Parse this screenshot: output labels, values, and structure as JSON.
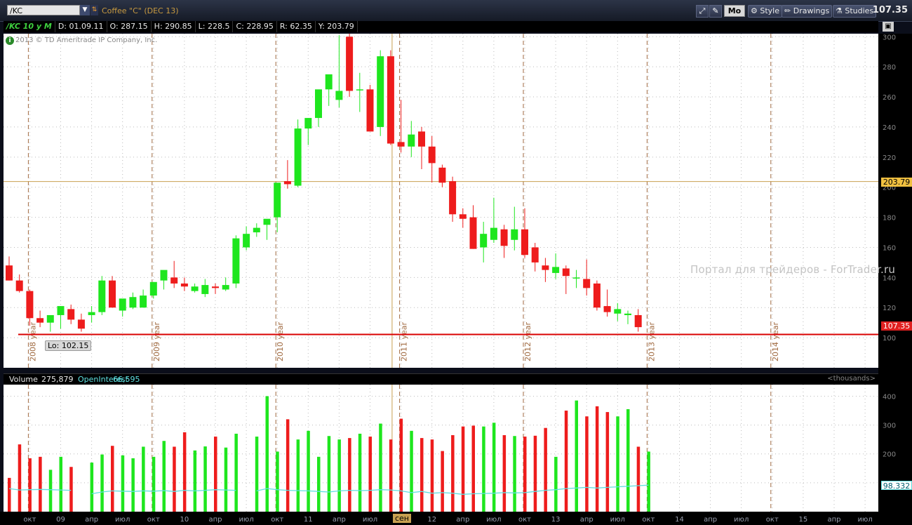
{
  "toolbar": {
    "symbol": "/KC",
    "description": "Coffee \"C\" (DEC 13)",
    "period_button": "Mo",
    "style_label": "Style",
    "drawings_label": "Drawings",
    "studies_label": "Studies",
    "last_price": "107.35"
  },
  "infobar": {
    "tag": "/KC 10 y M",
    "date": "D: 01.09.11",
    "open": "O: 287.15",
    "high": "H: 290.85",
    "low": "L: 228.5",
    "close": "C: 228.95",
    "range": "R: 62.35",
    "y": "Y: 203.79"
  },
  "copyright": "2013 © TD Ameritrade IP Company, Inc.",
  "watermark": "Портал для трейдеров - ForTrader.ru",
  "lo_label": "Lo: 102.15",
  "badges": {
    "crosshair_price": "203.79",
    "last_price": "107.35",
    "openinterest_value": "98.332",
    "crosshair_month": "сен"
  },
  "volume_header": {
    "volume_label": "Volume",
    "volume_value": "275,879",
    "oi_label": "OpenInterest",
    "oi_value": "66,595",
    "units": "<thousands>"
  },
  "colors": {
    "up": "#1ee61e",
    "down": "#ee1c1c",
    "openinterest": "#5fe0e0",
    "support_line": "#d90000",
    "crosshair": "#c8a050"
  },
  "chart_data": [
    {
      "type": "candlestick",
      "title": "",
      "xlabel": "",
      "ylabel": "",
      "ylim": [
        80,
        302
      ],
      "y_ticks": [
        100,
        120,
        140,
        160,
        180,
        200,
        220,
        240,
        260,
        280,
        300
      ],
      "support_level": 102.15,
      "crosshair_y": 203.79,
      "crosshair_date": "2011-09",
      "year_markers": [
        "2008 year",
        "2009 year",
        "2010 year",
        "2011 year",
        "2012 year",
        "2013 year",
        "2014 year"
      ],
      "year_marker_dates": [
        "2008-10",
        "2009-10",
        "2010-10",
        "2011-10",
        "2012-10",
        "2013-10",
        "2014-10"
      ],
      "start_month": "2008-08",
      "candles": [
        [
          148,
          154,
          138,
          138
        ],
        [
          138,
          142,
          130,
          131
        ],
        [
          131,
          132,
          108,
          113
        ],
        [
          113,
          118,
          107,
          110
        ],
        [
          110,
          112,
          104,
          115
        ],
        [
          115,
          121,
          106,
          121
        ],
        [
          119,
          122,
          109,
          112
        ],
        [
          112,
          116,
          104,
          106
        ],
        [
          115,
          121,
          110,
          117
        ],
        [
          117,
          141,
          115,
          138
        ],
        [
          138,
          141,
          120,
          120
        ],
        [
          118,
          124,
          114,
          126
        ],
        [
          120,
          130,
          119,
          127
        ],
        [
          120,
          132,
          120,
          128
        ],
        [
          128,
          137,
          126,
          137
        ],
        [
          138,
          140,
          132,
          145
        ],
        [
          140,
          151,
          133,
          136
        ],
        [
          136,
          140,
          131,
          134
        ],
        [
          131,
          136,
          130,
          134
        ],
        [
          129,
          139,
          127,
          135
        ],
        [
          134,
          136,
          129,
          133
        ],
        [
          132,
          140,
          131,
          135
        ],
        [
          136,
          168,
          133,
          166
        ],
        [
          160,
          174,
          158,
          169
        ],
        [
          170,
          176,
          167,
          173
        ],
        [
          175,
          176,
          165,
          179
        ],
        [
          180,
          197,
          170,
          203
        ],
        [
          204,
          218,
          199,
          202
        ],
        [
          201,
          245,
          200,
          239
        ],
        [
          239,
          246,
          228,
          246
        ],
        [
          246,
          258,
          240,
          265
        ],
        [
          265,
          272,
          254,
          275
        ],
        [
          258,
          301,
          253,
          264
        ],
        [
          300,
          302,
          260,
          264
        ],
        [
          265,
          276,
          250,
          265
        ],
        [
          265,
          268,
          237,
          237
        ],
        [
          240,
          291,
          234,
          287
        ],
        [
          287,
          291,
          228,
          229
        ],
        [
          230,
          258,
          223,
          227
        ],
        [
          227,
          244,
          220,
          235
        ],
        [
          237,
          240,
          212,
          227
        ],
        [
          227,
          234,
          203,
          216
        ],
        [
          213,
          215,
          200,
          203
        ],
        [
          204,
          207,
          177,
          182
        ],
        [
          182,
          186,
          173,
          179
        ],
        [
          180,
          188,
          159,
          159
        ],
        [
          160,
          177,
          150,
          169
        ],
        [
          165,
          193,
          163,
          173
        ],
        [
          172,
          175,
          153,
          161
        ],
        [
          165,
          187,
          158,
          172
        ],
        [
          172,
          186,
          153,
          155
        ],
        [
          160,
          163,
          144,
          150
        ],
        [
          148,
          153,
          137,
          145
        ],
        [
          143,
          156,
          139,
          147
        ],
        [
          146,
          148,
          129,
          141
        ],
        [
          140,
          145,
          133,
          140
        ],
        [
          139,
          152,
          128,
          133
        ],
        [
          136,
          138,
          118,
          120
        ],
        [
          121,
          132,
          114,
          117
        ],
        [
          116,
          123,
          111,
          119
        ],
        [
          115,
          118,
          109,
          116
        ],
        [
          115,
          119,
          104,
          107
        ]
      ]
    },
    {
      "type": "bar",
      "title": "Volume",
      "ylabel": "thousands",
      "ylim": [
        0,
        440
      ],
      "y_ticks": [
        100,
        200,
        300,
        400
      ],
      "volume": [
        117,
        233,
        185,
        190,
        145,
        190,
        155,
        0,
        170,
        198,
        228,
        195,
        185,
        225,
        190,
        245,
        225,
        275,
        212,
        226,
        260,
        222,
        270,
        0,
        260,
        400,
        208,
        320,
        250,
        280,
        190,
        262,
        250,
        255,
        270,
        260,
        305,
        250,
        322,
        280,
        255,
        250,
        210,
        265,
        295,
        298,
        295,
        308,
        265,
        262,
        260,
        263,
        290,
        190,
        350,
        385,
        330,
        365,
        345,
        330,
        355,
        225,
        208
      ],
      "openinterest": [
        80,
        75,
        76,
        77,
        76,
        75,
        74,
        0,
        62,
        68,
        72,
        71,
        70,
        72,
        71,
        73,
        70,
        74,
        72,
        74,
        76,
        75,
        74,
        0,
        72,
        80,
        76,
        74,
        73,
        72,
        70,
        68,
        72,
        74,
        73,
        74,
        76,
        75,
        72,
        66,
        70,
        64,
        66,
        64,
        60,
        62,
        63,
        64,
        66,
        65,
        66,
        70,
        74,
        76,
        80,
        82,
        84,
        82,
        84,
        86,
        88,
        90,
        92
      ]
    }
  ],
  "x_axis_labels": [
    "окт",
    "09",
    "апр",
    "июл",
    "окт",
    "10",
    "апр",
    "июл",
    "окт",
    "11",
    "апр",
    "июл",
    "сен",
    "12",
    "апр",
    "июл",
    "окт",
    "13",
    "апр",
    "июл",
    "окт",
    "14",
    "апр",
    "июл",
    "окт",
    "15",
    "апр",
    "июл"
  ]
}
